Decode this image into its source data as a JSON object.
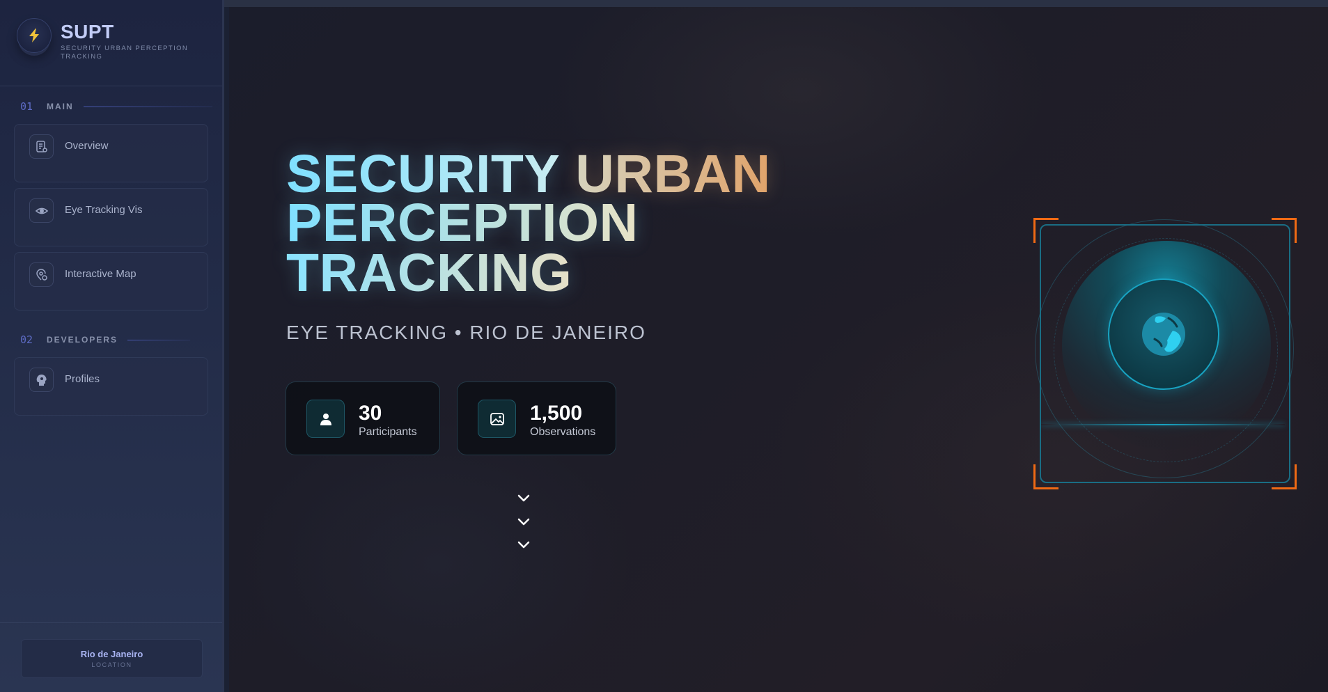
{
  "brand": {
    "title": "SUPT",
    "subtitle": "SECURITY URBAN PERCEPTION TRACKING",
    "logo_icon": "lightning-bolt-icon"
  },
  "sidebar": {
    "sections": [
      {
        "number": "01",
        "label": "MAIN",
        "items": [
          {
            "label": "Overview",
            "icon": "document-edit-icon"
          },
          {
            "label": "Eye Tracking Vis",
            "icon": "eye-icon"
          },
          {
            "label": "Interactive Map",
            "icon": "map-pin-icon"
          }
        ]
      },
      {
        "number": "02",
        "label": "DEVELOPERS",
        "items": [
          {
            "label": "Profiles",
            "icon": "head-profile-icon"
          }
        ]
      }
    ],
    "footer": {
      "location_name": "Rio de Janeiro",
      "location_label": "LOCATION"
    }
  },
  "hero": {
    "title_words": {
      "security": "SECURITY",
      "urban": "URBAN",
      "perception": "PERCEPTION",
      "tracking": "TRACKING"
    },
    "subtitle": "EYE TRACKING • RIO DE JANEIRO",
    "stats": [
      {
        "value": "30",
        "label": "Participants",
        "icon": "person-icon"
      },
      {
        "value": "1,500",
        "label": "Observations",
        "icon": "image-icon"
      }
    ],
    "scroll_indicator_icon": "chevron-down-icon"
  },
  "colors": {
    "accent_cyan": "#18a3c2",
    "accent_orange": "#f06a14",
    "sidebar_accent": "#5d6bc4",
    "location_text": "#a9b4f2"
  }
}
